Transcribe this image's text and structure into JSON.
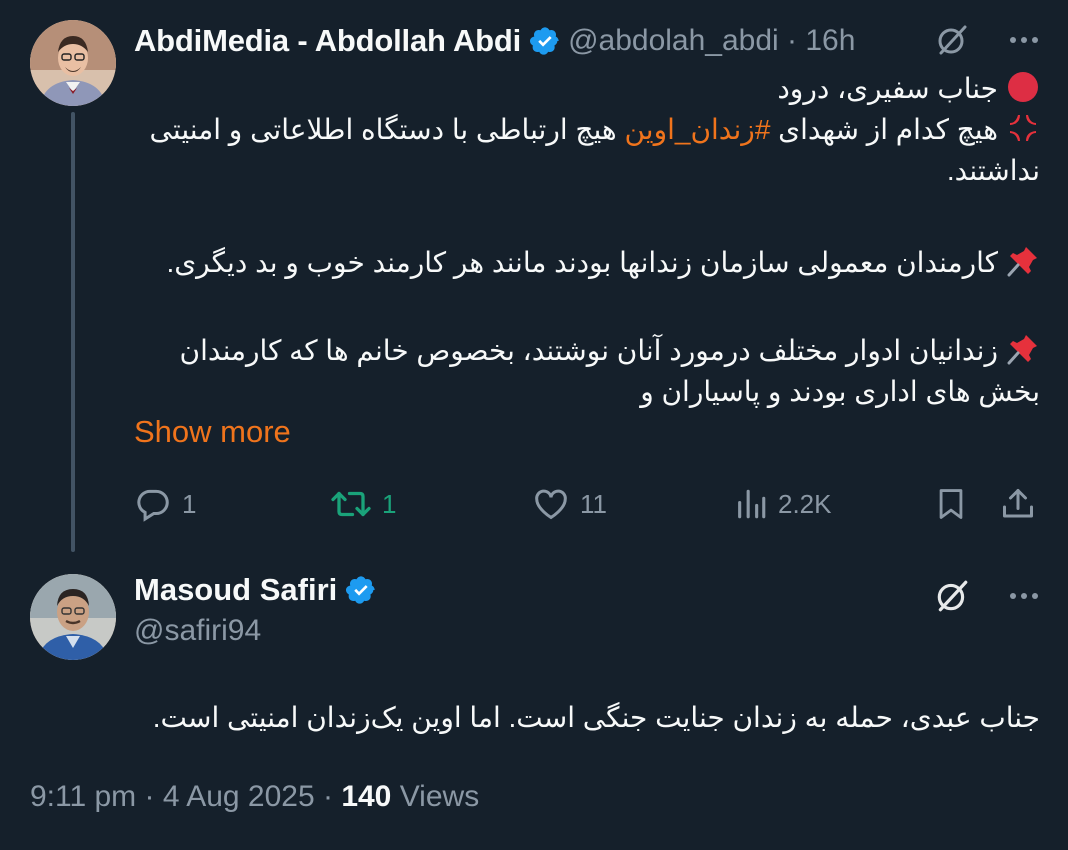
{
  "parent": {
    "author_name": "AbdiMedia - Abdollah Abdi",
    "handle": "@abdolah_abdi",
    "time": "16h",
    "line1": "جناب سفیری، درود",
    "line2_before": "هیچ کدام از شهدای ",
    "hashtag": "#زندان_اوین",
    "line2_after": " هیچ ارتباطی با دستگاه اطلاعاتی و امنیتی نداشتند.",
    "para2": "کارمندان معمولی سازمان زندانها بودند مانند هر کارمند خوب و بد دیگری.",
    "para3": "زندانیان ادوار مختلف درمورد آنان نوشتند، بخصوص خانم ها که کارمندان بخش های اداری بودند و پاسیاران و",
    "show_more": "Show more",
    "actions": {
      "replies": "1",
      "reposts": "1",
      "likes": "11",
      "views": "2.2K"
    },
    "icons": {
      "line1": "red-circle-icon",
      "line2": "anger-symbol-icon",
      "para2": "pushpin-icon",
      "para3": "pushpin-icon"
    }
  },
  "reply": {
    "author_name": "Masoud Safiri",
    "handle": "@safiri94",
    "text": "جناب عبدی، حمله به زندان جنایت جنگی است. اما اوین یک‌زندان امنیتی است.",
    "date": "9:11 pm · 4 Aug 2025 · ",
    "views_count": "140",
    "views_label": " Views"
  },
  "colors": {
    "background": "#15202b",
    "accent": "#f0741c",
    "verified": "#1d9bf0",
    "muted": "#8b98a5",
    "repost": "#1aa37a"
  }
}
